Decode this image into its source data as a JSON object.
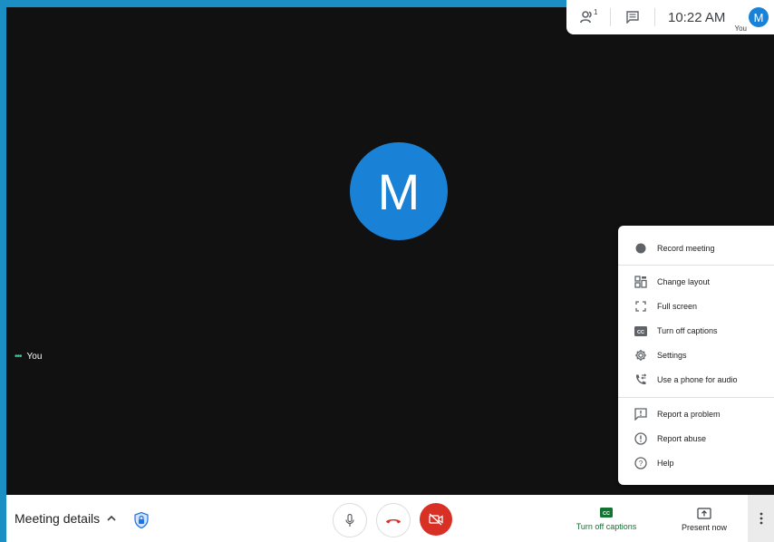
{
  "top_bar": {
    "participants_count": "1",
    "time": "10:22 AM",
    "user_initial": "M",
    "user_label": "You"
  },
  "main": {
    "avatar_initial": "M",
    "self_label": "You"
  },
  "menu": {
    "items": [
      {
        "label": "Record meeting",
        "icon": "record-icon"
      },
      {
        "label": "Change layout",
        "icon": "layout-icon"
      },
      {
        "label": "Full screen",
        "icon": "fullscreen-icon"
      },
      {
        "label": "Turn off captions",
        "icon": "captions-icon"
      },
      {
        "label": "Settings",
        "icon": "gear-icon"
      },
      {
        "label": "Use a phone for audio",
        "icon": "phone-icon"
      },
      {
        "label": "Report a problem",
        "icon": "report-problem-icon"
      },
      {
        "label": "Report abuse",
        "icon": "alert-icon"
      },
      {
        "label": "Help",
        "icon": "help-icon"
      }
    ]
  },
  "bottom_bar": {
    "meeting_details": "Meeting details",
    "captions_label": "Turn off captions",
    "present_label": "Present now"
  },
  "colors": {
    "accent": "#1a82d6",
    "danger": "#d93025",
    "captions_green": "#137333",
    "stage": "#111111"
  }
}
